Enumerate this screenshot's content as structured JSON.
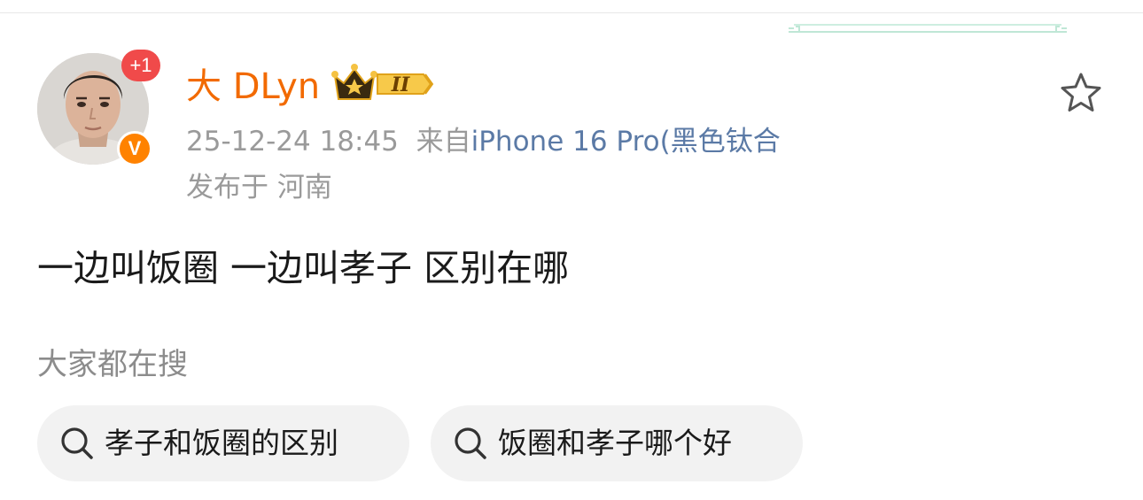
{
  "post": {
    "avatar": {
      "notification_badge": "+1",
      "verified_badge": "V"
    },
    "username": "大 DLyn",
    "level_badge": "II",
    "timestamp": "25-12-24 18:45",
    "from_prefix": "来自",
    "source": "iPhone 16 Pro(黑色钛合",
    "location": "发布于 河南",
    "content": "一边叫饭圈 一边叫孝子 区别在哪",
    "favorite_icon": "star-outline-icon"
  },
  "related_search": {
    "title": "大家都在搜",
    "chips": [
      {
        "label": "孝子和饭圈的区别",
        "icon": "search-icon"
      },
      {
        "label": "饭圈和孝子哪个好",
        "icon": "search-icon"
      }
    ]
  },
  "colors": {
    "username": "#f26a00",
    "source": "#5b7aa6",
    "muted": "#9a9a9a",
    "badge_red": "#f04a4a",
    "verified_orange": "#ff8200",
    "chip_bg": "#f2f2f2"
  }
}
